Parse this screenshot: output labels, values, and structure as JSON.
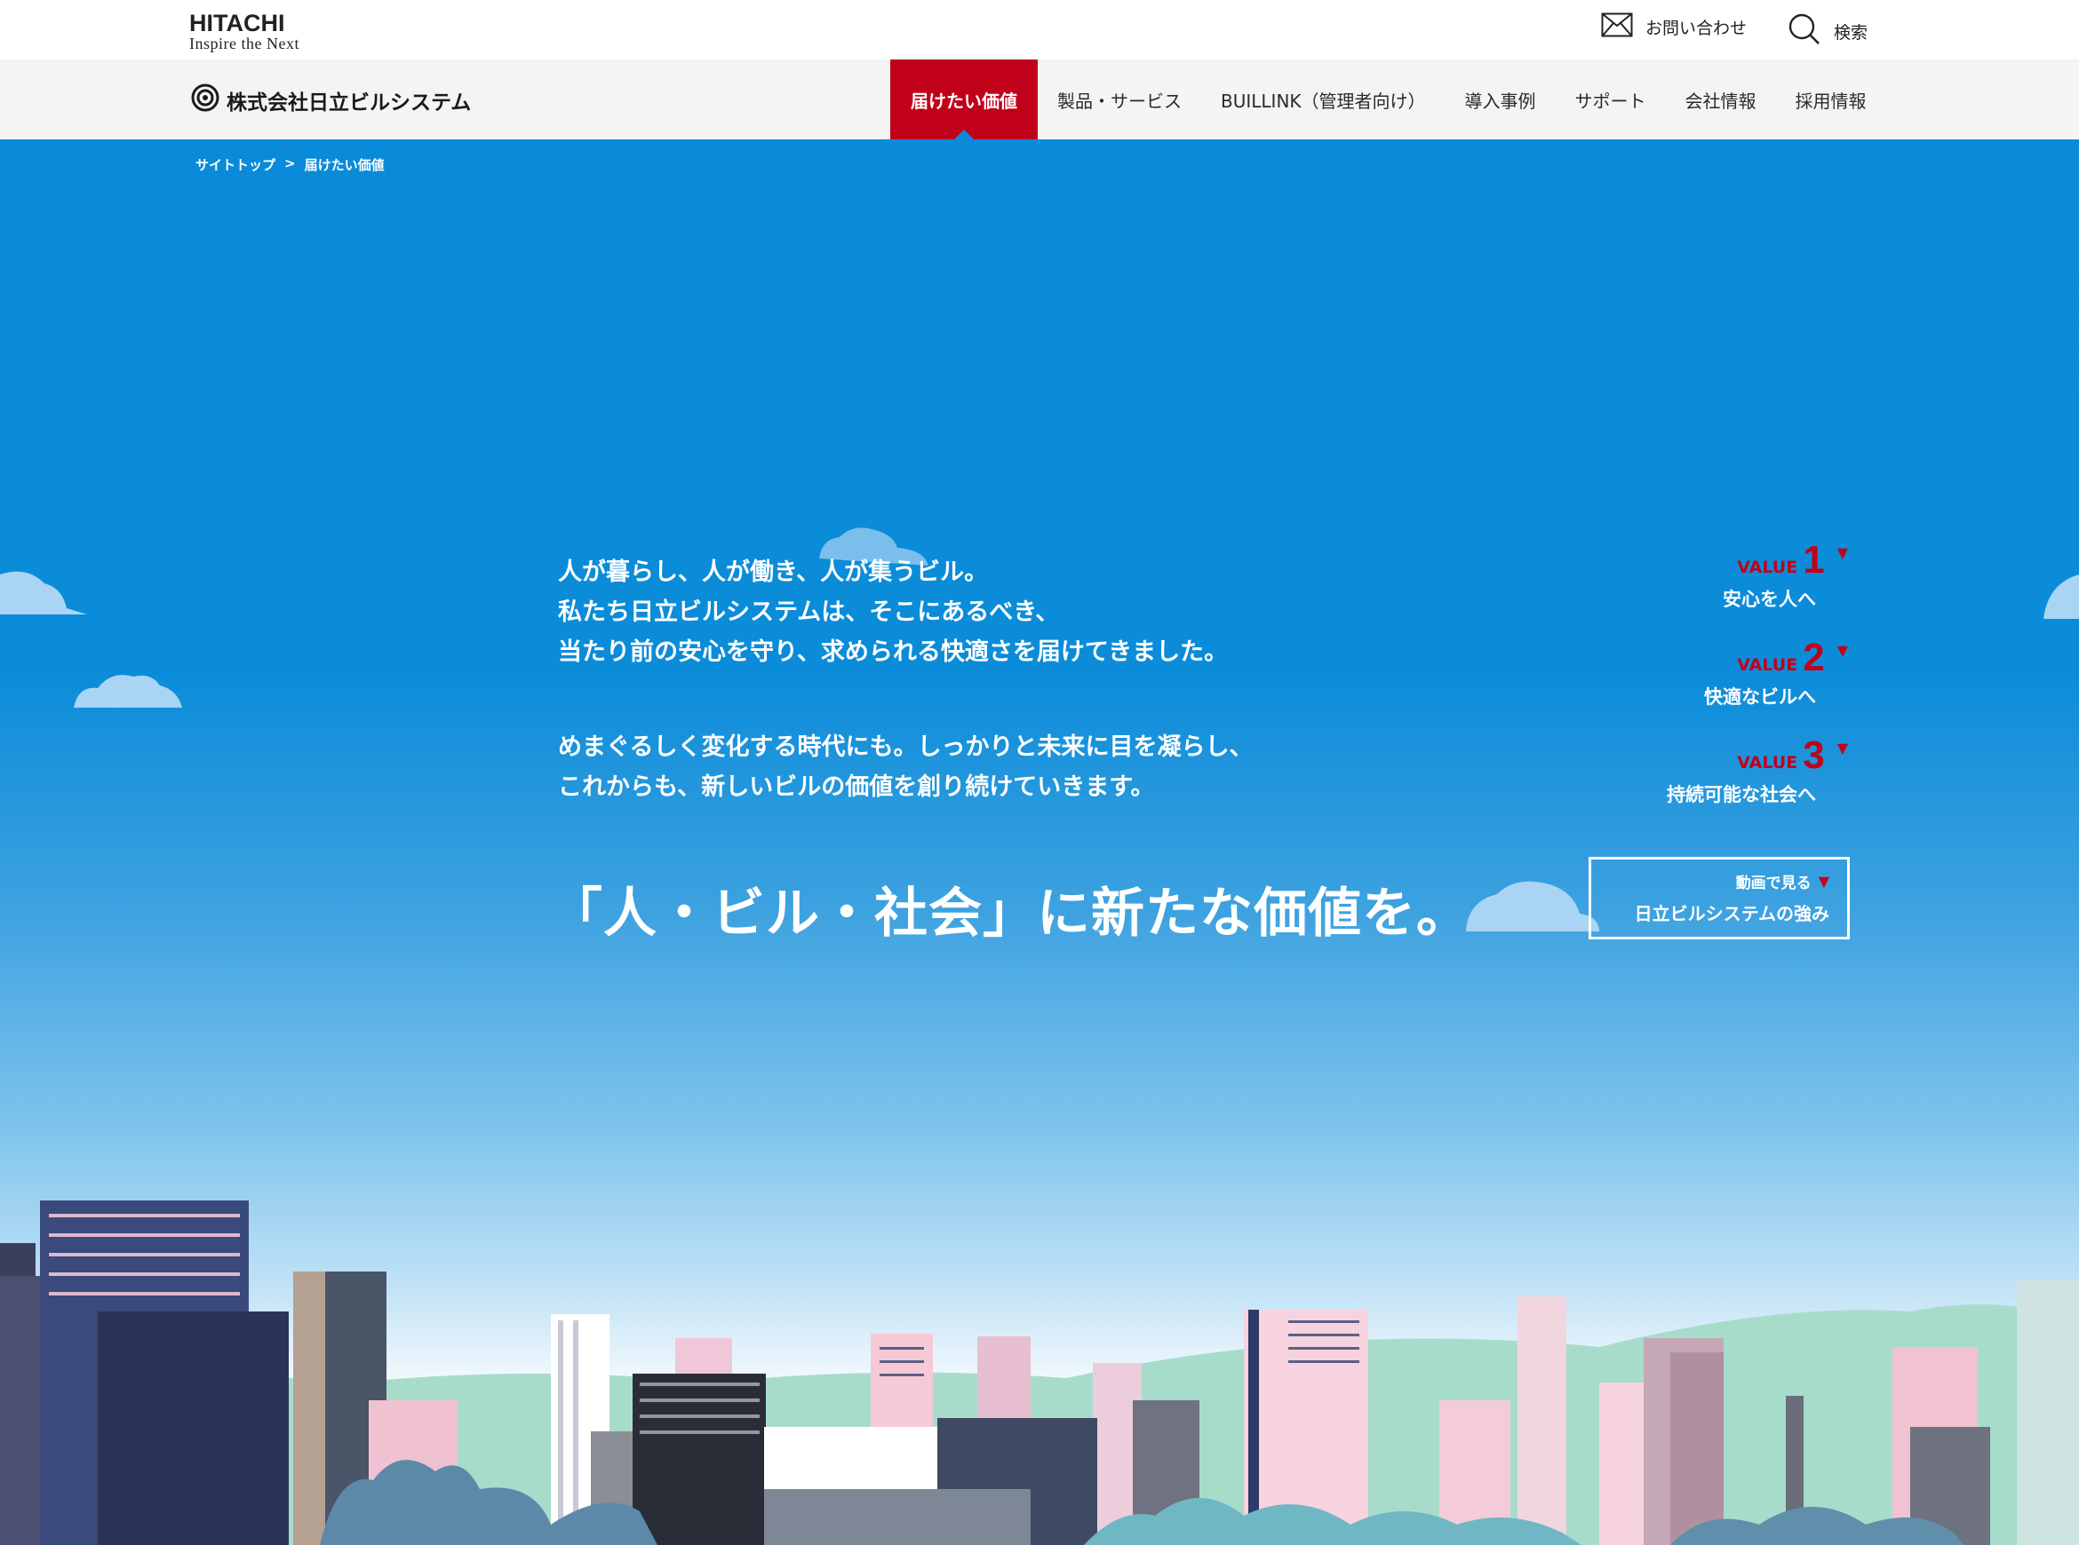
{
  "header": {
    "logo_main": "HITACHI",
    "logo_sub": "Inspire the Next",
    "contact_label": "お問い合わせ",
    "search_label": "検索"
  },
  "nav": {
    "company_name": "株式会社日立ビルシステム",
    "items": [
      {
        "label": "届けたい価値",
        "active": true
      },
      {
        "label": "製品・サービス",
        "active": false
      },
      {
        "label": "BUILLINK（管理者向け）",
        "active": false
      },
      {
        "label": "導入事例",
        "active": false
      },
      {
        "label": "サポート",
        "active": false
      },
      {
        "label": "会社情報",
        "active": false
      },
      {
        "label": "採用情報",
        "active": false
      }
    ]
  },
  "breadcrumb": {
    "top": "サイトトップ",
    "separator": ">",
    "current": "届けたい価値"
  },
  "hero": {
    "paragraph1": [
      "人が暮らし、人が働き、人が集うビル。",
      "私たち日立ビルシステムは、そこにあるべき、",
      "当たり前の安心を守り、求められる快適さを届けてきました。"
    ],
    "paragraph2": [
      "めまぐるしく変化する時代にも。しっかりと未来に目を凝らし、",
      "これからも、新しいビルの価値を創り続けていきます。"
    ],
    "headline": "「人・ビル・社会」に新たな価値を。"
  },
  "values": [
    {
      "label": "VALUE",
      "number": "1",
      "desc": "安心を人へ"
    },
    {
      "label": "VALUE",
      "number": "2",
      "desc": "快適なビルへ"
    },
    {
      "label": "VALUE",
      "number": "3",
      "desc": "持続可能な社会へ"
    }
  ],
  "movie": {
    "line1": "動画で見る",
    "line2": "日立ビルシステムの強み"
  },
  "colors": {
    "accent_red": "#c1001a",
    "sky_blue": "#0a8bd9",
    "nav_bg": "#f4f4f4"
  }
}
